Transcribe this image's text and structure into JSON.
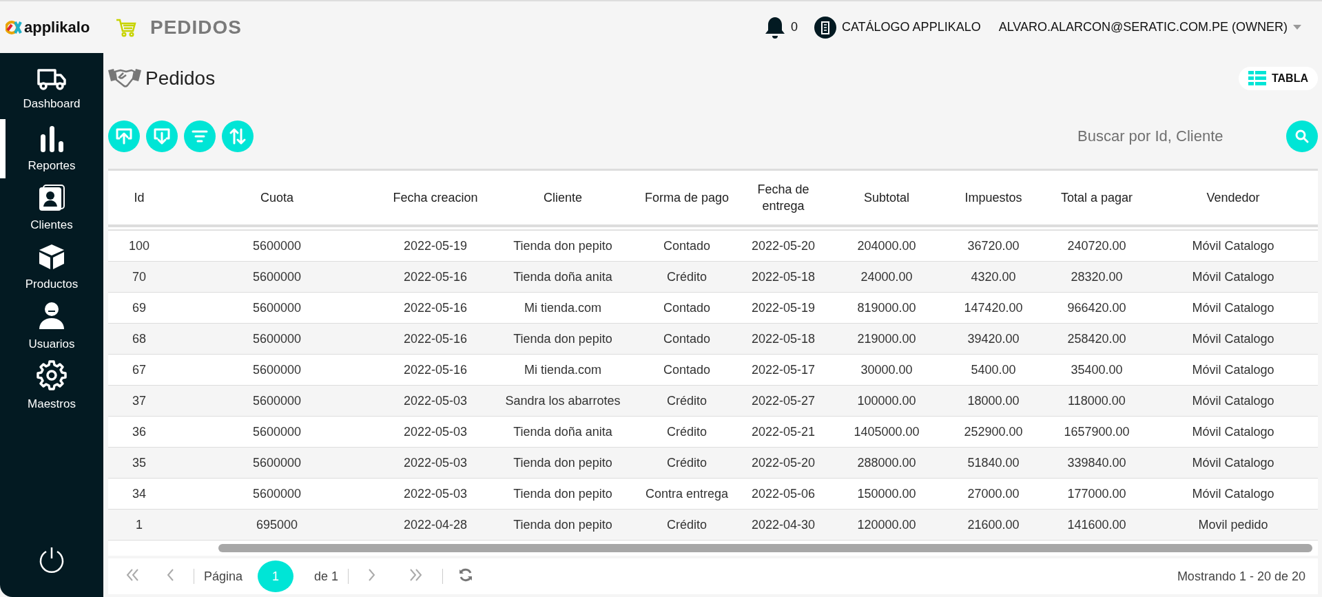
{
  "header": {
    "logo": "applikalo",
    "module": "PEDIDOS",
    "notifications": "0",
    "company": "CATÁLOGO APPLIKALO",
    "user": "ALVARO.ALARCON@SERATIC.COM.PE (OWNER)"
  },
  "sidebar": {
    "items": [
      {
        "label": "Dashboard",
        "selected": false
      },
      {
        "label": "Reportes",
        "selected": true
      },
      {
        "label": "Clientes",
        "selected": false
      },
      {
        "label": "Productos",
        "selected": false
      },
      {
        "label": "Usuarios",
        "selected": false
      },
      {
        "label": "Maestros",
        "selected": false
      }
    ]
  },
  "page": {
    "title": "Pedidos",
    "view_button": "TABLA"
  },
  "search": {
    "placeholder": "Buscar por Id, Cliente"
  },
  "table": {
    "columns": [
      "Id",
      "Cuota",
      "Fecha creacion",
      "Cliente",
      "Forma de pago",
      "Fecha de entrega",
      "Subtotal",
      "Impuestos",
      "Total a pagar",
      "Vendedor"
    ],
    "rows": [
      [
        "100",
        "5600000",
        "2022-05-19",
        "Tienda don pepito",
        "Contado",
        "2022-05-20",
        "204000.00",
        "36720.00",
        "240720.00",
        "Móvil Catalogo"
      ],
      [
        "70",
        "5600000",
        "2022-05-16",
        "Tienda doña anita",
        "Crédito",
        "2022-05-18",
        "24000.00",
        "4320.00",
        "28320.00",
        "Móvil Catalogo"
      ],
      [
        "69",
        "5600000",
        "2022-05-16",
        "Mi tienda.com",
        "Contado",
        "2022-05-19",
        "819000.00",
        "147420.00",
        "966420.00",
        "Móvil Catalogo"
      ],
      [
        "68",
        "5600000",
        "2022-05-16",
        "Tienda don pepito",
        "Contado",
        "2022-05-18",
        "219000.00",
        "39420.00",
        "258420.00",
        "Móvil Catalogo"
      ],
      [
        "67",
        "5600000",
        "2022-05-16",
        "Mi tienda.com",
        "Contado",
        "2022-05-17",
        "30000.00",
        "5400.00",
        "35400.00",
        "Móvil Catalogo"
      ],
      [
        "37",
        "5600000",
        "2022-05-03",
        "Sandra los abarrotes",
        "Crédito",
        "2022-05-27",
        "100000.00",
        "18000.00",
        "118000.00",
        "Móvil Catalogo"
      ],
      [
        "36",
        "5600000",
        "2022-05-03",
        "Tienda doña anita",
        "Crédito",
        "2022-05-21",
        "1405000.00",
        "252900.00",
        "1657900.00",
        "Móvil Catalogo"
      ],
      [
        "35",
        "5600000",
        "2022-05-03",
        "Tienda don pepito",
        "Crédito",
        "2022-05-20",
        "288000.00",
        "51840.00",
        "339840.00",
        "Móvil Catalogo"
      ],
      [
        "34",
        "5600000",
        "2022-05-03",
        "Tienda don pepito",
        "Contra entrega",
        "2022-05-06",
        "150000.00",
        "27000.00",
        "177000.00",
        "Móvil Catalogo"
      ],
      [
        "1",
        "695000",
        "2022-04-28",
        "Tienda don pepito",
        "Crédito",
        "2022-04-30",
        "120000.00",
        "21600.00",
        "141600.00",
        "Movil pedido"
      ]
    ]
  },
  "pager": {
    "label": "Página",
    "page": "1",
    "of": "de 1",
    "summary": "Mostrando 1 - 20 de 20"
  }
}
